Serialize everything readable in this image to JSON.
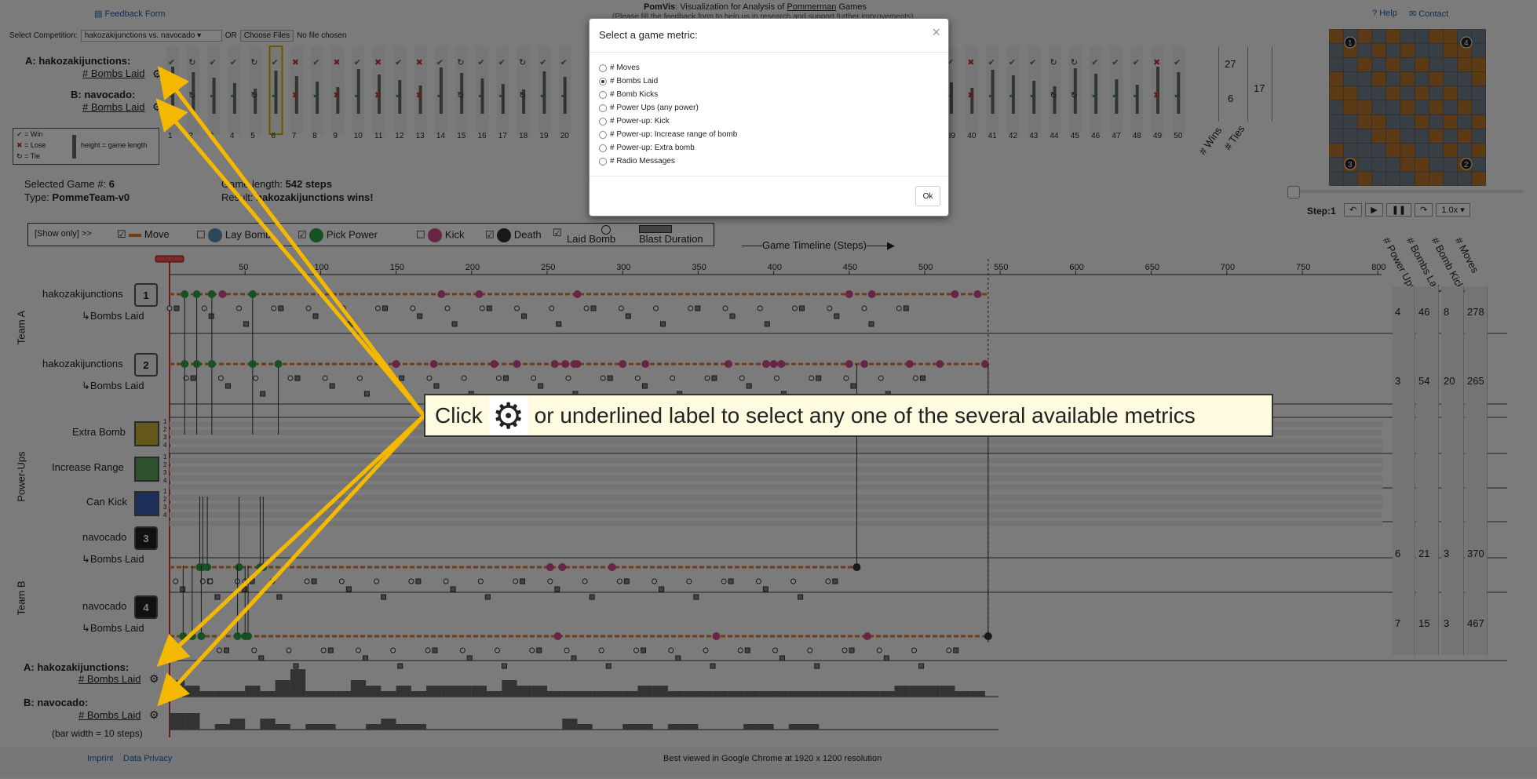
{
  "header": {
    "feedback_link": "Feedback Form",
    "app_name": "PomVis",
    "title_rest": ": Visualization for Analysis of ",
    "title_game": "Pommerman",
    "title_end": " Games",
    "subtitle": "(Please fill the feedback form to help us in research and support further improvements)",
    "help": "Help",
    "contact": "Contact"
  },
  "controls": {
    "competition_label": "Select Competition:",
    "competition_value": "hakozakijunctions vs. navocado",
    "or_label": "OR",
    "choose_files": "Choose Files",
    "no_file": "No file chosen"
  },
  "teams": {
    "a_label": "A: hakozakijunctions:",
    "b_label": "B: navocado:",
    "metric_label": "# Bombs Laid",
    "wins_a": "27",
    "wins_b": "6",
    "ties": "17",
    "wins_axis": "# Wins",
    "ties_axis": "# Ties"
  },
  "legend_box": {
    "win": "= Win",
    "lose": "= Lose",
    "tie": "= Tie",
    "height": "height = game length"
  },
  "game_numbers": [
    "1",
    "2",
    "3",
    "4",
    "5",
    "6",
    "7",
    "8",
    "9",
    "10",
    "11",
    "12",
    "13",
    "14",
    "15",
    "16",
    "17",
    "18",
    "19",
    "20",
    "39",
    "40",
    "41",
    "42",
    "43",
    "44",
    "45",
    "46",
    "47",
    "48",
    "49",
    "50"
  ],
  "selected_game": {
    "label": "Selected Game #:",
    "value": "6",
    "type_label": "Type:",
    "type_value": "PommeTeam-v0",
    "length_label": "Game length:",
    "length_value": "542 steps",
    "result_label": "Result:",
    "result_value": "hakozakijunctions wins!"
  },
  "playback": {
    "step_label": "Step:1",
    "speed": "1.0x"
  },
  "filters": {
    "show_only": "[Show only] >>",
    "move": "Move",
    "lay_bomb": "Lay Bomb",
    "pick_power": "Pick Power",
    "kick": "Kick",
    "death": "Death",
    "laid_bomb": "Laid Bomb",
    "blast_duration": "Blast Duration"
  },
  "timeline": {
    "title": "Game Timeline (Steps)",
    "ticks": [
      "50",
      "100",
      "150",
      "200",
      "250",
      "300",
      "350",
      "400",
      "450",
      "500",
      "550",
      "600",
      "650",
      "700",
      "750",
      "800"
    ]
  },
  "rows": {
    "team_a": "Team A",
    "team_b": "Team B",
    "power_ups": "Power-Ups",
    "bombs_laid": "Bombs Laid",
    "agents": [
      {
        "name": "hakozakijunctions",
        "id": "1"
      },
      {
        "name": "hakozakijunctions",
        "id": "2"
      },
      {
        "name": "navocado",
        "id": "3"
      },
      {
        "name": "navocado",
        "id": "4"
      }
    ],
    "powerups": [
      "Extra Bomb",
      "Increase Range",
      "Can Kick"
    ],
    "pu_lanes": [
      "1",
      "2",
      "3",
      "4"
    ]
  },
  "stats": {
    "headers": [
      "# Power Ups",
      "# Bombs Laid",
      "# Bomb Kicks",
      "# Moves"
    ],
    "values": [
      [
        "4",
        "46",
        "8",
        "278"
      ],
      [
        "3",
        "54",
        "20",
        "265"
      ],
      [
        "6",
        "21",
        "3",
        "370"
      ],
      [
        "7",
        "15",
        "3",
        "467"
      ]
    ]
  },
  "bottom": {
    "a_label": "A: hakozakijunctions:",
    "b_label": "B: navocado:",
    "metric": "# Bombs Laid",
    "bar_note": "(bar width = 10 steps)"
  },
  "footer": {
    "imprint": "Imprint",
    "privacy": "Data Privacy",
    "note": "Best viewed in Google Chrome at 1920 x 1200 resolution"
  },
  "modal": {
    "title": "Select a game metric:",
    "close": "×",
    "options": [
      {
        "label": "# Moves",
        "selected": false
      },
      {
        "label": "# Bombs Laid",
        "selected": true
      },
      {
        "label": "# Bomb Kicks",
        "selected": false
      },
      {
        "label": "# Power Ups (any power)",
        "selected": false
      },
      {
        "label": "# Power-up: Kick",
        "selected": false
      },
      {
        "label": "# Power-up: Increase range of bomb",
        "selected": false
      },
      {
        "label": "# Power-up: Extra bomb",
        "selected": false
      },
      {
        "label": "# Radio Messages",
        "selected": false
      }
    ],
    "ok": "Ok"
  },
  "callout": {
    "before": "Click",
    "after": "or underlined label to select any one of the several available metrics"
  },
  "colors": {
    "move": "#e07a2f",
    "bomb": "#5b8fb0",
    "power": "#2ea043",
    "kick": "#d04a8a",
    "death": "#333333",
    "arrow": "#f5b800",
    "win": "#2a8a3a",
    "lose": "#c0392b"
  }
}
